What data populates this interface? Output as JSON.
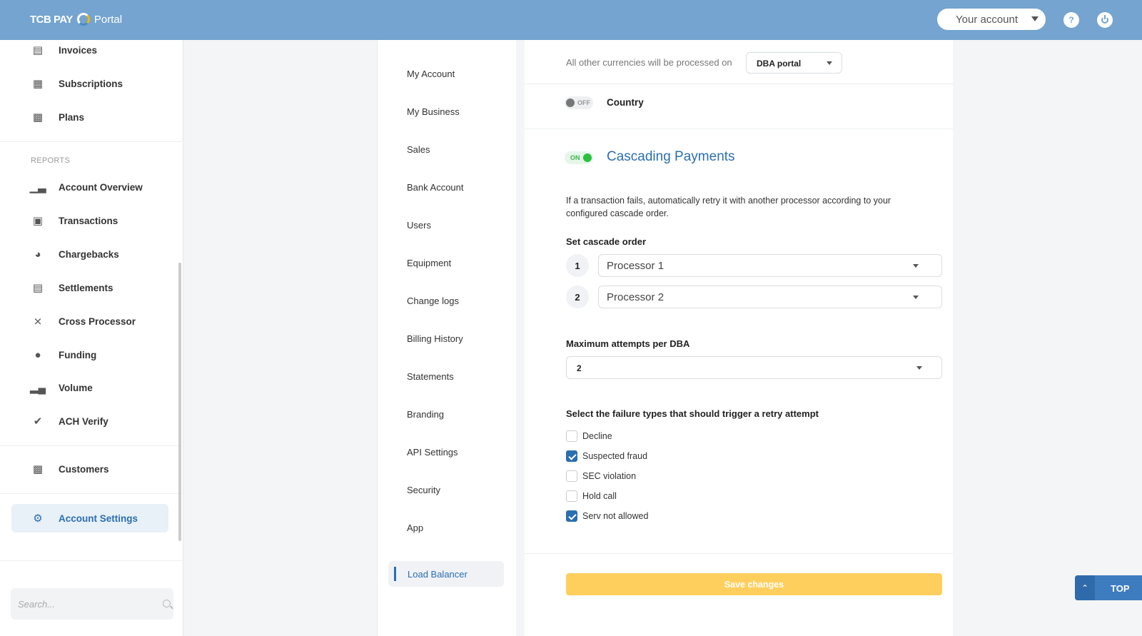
{
  "header": {
    "brand": "TCB PAY",
    "portal": "Portal",
    "account_label": "Your account",
    "help_icon": "?"
  },
  "sidebar": {
    "items_top": [
      {
        "label": "Invoices",
        "icon": "invoice-icon"
      },
      {
        "label": "Subscriptions",
        "icon": "subscriptions-icon"
      },
      {
        "label": "Plans",
        "icon": "plans-icon"
      }
    ],
    "reports_label": "REPORTS",
    "reports": [
      {
        "label": "Account Overview",
        "icon": "bar-chart-icon"
      },
      {
        "label": "Transactions",
        "icon": "transactions-icon"
      },
      {
        "label": "Chargebacks",
        "icon": "chargebacks-icon"
      },
      {
        "label": "Settlements",
        "icon": "clipboard-icon"
      },
      {
        "label": "Cross Processor",
        "icon": "shuffle-icon"
      },
      {
        "label": "Funding",
        "icon": "funding-icon"
      },
      {
        "label": "Volume",
        "icon": "volume-icon"
      },
      {
        "label": "ACH Verify",
        "icon": "verified-icon"
      }
    ],
    "customers": {
      "label": "Customers",
      "icon": "contacts-icon"
    },
    "account_settings": {
      "label": "Account Settings",
      "icon": "gear-icon"
    },
    "search_placeholder": "Search..."
  },
  "settings_nav": {
    "items": [
      "My Account",
      "My Business",
      "Sales",
      "Bank Account",
      "Users",
      "Equipment",
      "Change logs",
      "Billing History",
      "Statements",
      "Branding",
      "API Settings",
      "Security",
      "App"
    ],
    "active": "Load Balancer"
  },
  "main": {
    "other_currencies_text": "All other currencies will be processed on",
    "dba_portal_value": "DBA portal",
    "country_toggle": "OFF",
    "country_label": "Country",
    "cascade_toggle": "ON",
    "cascade_title": "Cascading Payments",
    "cascade_description": "If a transaction fails, automatically retry it with another processor according to your configured cascade order.",
    "cascade_order_label": "Set cascade order",
    "cascade_order": [
      {
        "num": "1",
        "processor": "Processor 1"
      },
      {
        "num": "2",
        "processor": "Processor 2"
      }
    ],
    "max_attempts_label": "Maximum attempts per DBA",
    "max_attempts_value": "2",
    "failure_types_label": "Select the failure types that should trigger a retry attempt",
    "failure_types": [
      {
        "label": "Decline",
        "checked": false
      },
      {
        "label": "Suspected fraud",
        "checked": true
      },
      {
        "label": "SEC violation",
        "checked": false
      },
      {
        "label": "Hold call",
        "checked": false
      },
      {
        "label": "Serv not allowed",
        "checked": true
      }
    ],
    "save_label": "Save changes"
  },
  "top_button": {
    "label": "TOP"
  },
  "colors": {
    "header": "#74a4cf",
    "accent": "#2a6fb0",
    "save": "#ffcf5e",
    "toggle_on": "#2bbf3f"
  }
}
